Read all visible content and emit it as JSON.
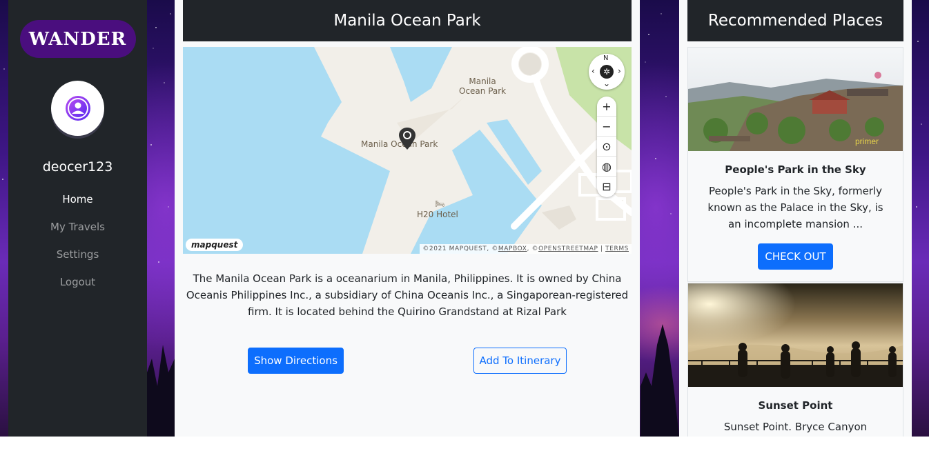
{
  "app": {
    "brand": "WANDER"
  },
  "sidebar": {
    "username": "deocer123",
    "nav": [
      {
        "label": "Home",
        "active": true
      },
      {
        "label": "My Travels",
        "active": false
      },
      {
        "label": "Settings",
        "active": false
      },
      {
        "label": "Logout",
        "active": false
      }
    ]
  },
  "main": {
    "title": "Manila Ocean Park",
    "map": {
      "labels": {
        "poi_manila_ocean_park_line1": "Manila",
        "poi_manila_ocean_park_line2": "Ocean Park",
        "marker_label": "Manila Ocean Park",
        "hotel": "H20 Hotel"
      },
      "compass_north": "N",
      "controls": [
        "zoom-in",
        "zoom-out",
        "locate",
        "globe",
        "traffic"
      ],
      "logo": "mapquest",
      "attribution": {
        "prefix": "©2021 MAPQUEST, ©",
        "mapbox": "MAPBOX",
        "sep": ", ©",
        "osm": "OPENSTREETMAP",
        "divider": " | ",
        "terms": "TERMS"
      }
    },
    "description": "The Manila Ocean Park is a oceanarium in Manila, Philippines. It is owned by China Oceanis Philippines Inc., a subsidiary of China Oceanis Inc., a Singaporean-registered firm. It is located behind the Quirino Grandstand at Rizal Park",
    "buttons": {
      "directions": "Show Directions",
      "itinerary": "Add To Itinerary"
    }
  },
  "recommended": {
    "title": "Recommended Places",
    "cards": [
      {
        "title": "People's Park in the Sky",
        "text": "People's Park in the Sky, formerly known as the Palace in the Sky, is an incomplete mansion ...",
        "button": "CHECK OUT",
        "image_watermark": "primer"
      },
      {
        "title": "Sunset Point",
        "text": "Sunset Point. Bryce Canyon National"
      }
    ]
  },
  "colors": {
    "sidebar_bg": "#212529",
    "brand_bg": "#4a0e7e",
    "primary": "#0d6efd",
    "water": "#aadcf3",
    "land": "#f2efe9"
  }
}
